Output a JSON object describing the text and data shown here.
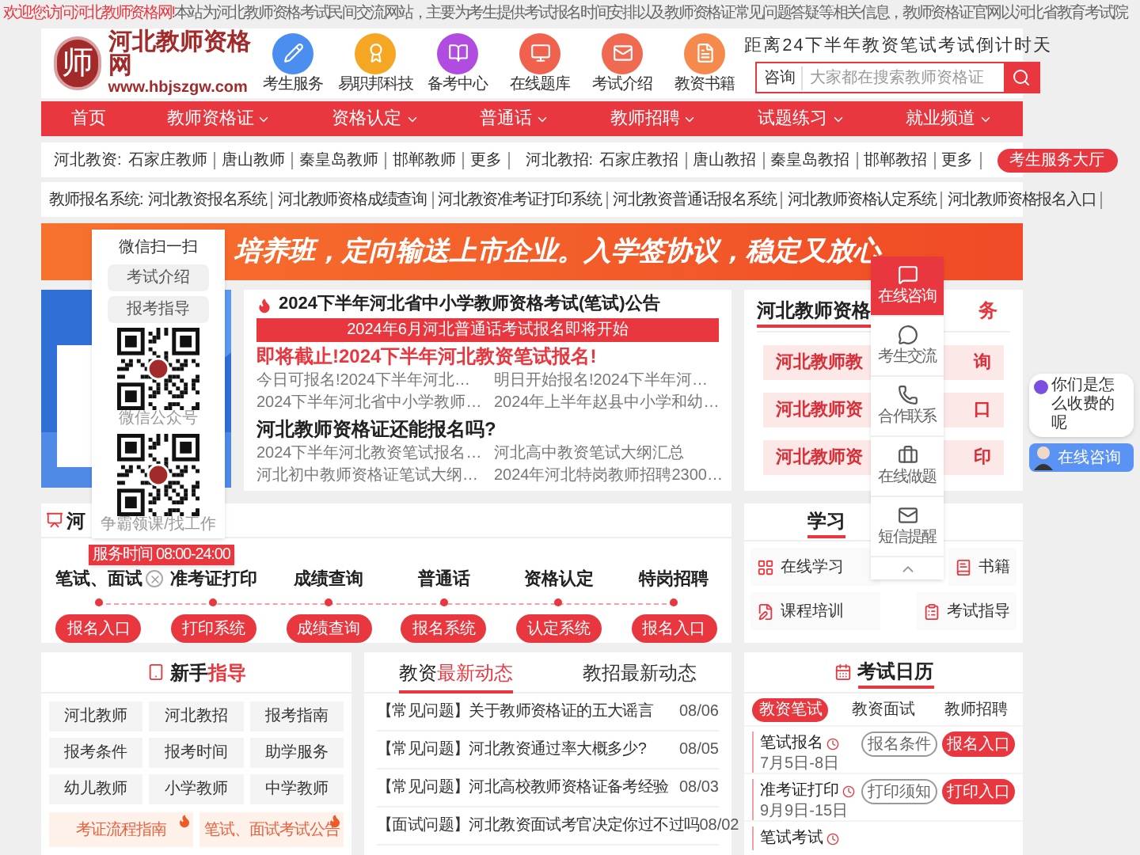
{
  "notice": {
    "welcome": "欢迎您访问河北教师资格网!",
    "text": "本站为河北教师资格考试民间交流网站，主要为考生提供考试报名时间安排以及教师资格证常见问题答疑等相关信息，教师资格证官网以河北省教育考试院"
  },
  "header": {
    "logo_mark": "师",
    "site_name": "河北教师资格网",
    "site_url": "www.hbjszgw.com",
    "shortcuts": [
      {
        "label": "考生服务",
        "color": "#4a8ef0"
      },
      {
        "label": "易职邦科技",
        "color": "#f5a623"
      },
      {
        "label": "备考中心",
        "color": "#b04ce0"
      },
      {
        "label": "在线题库",
        "color": "#f0624d"
      },
      {
        "label": "考试介绍",
        "color": "#f06a52"
      },
      {
        "label": "教资书籍",
        "color": "#f58a4c"
      }
    ],
    "countdown": "距离24下半年教资笔试考试倒计时天",
    "search": {
      "label": "咨询",
      "placeholder": "大家都在搜索教师资格证"
    }
  },
  "nav": [
    {
      "label": "首页",
      "dropdown": false
    },
    {
      "label": "教师资格证",
      "dropdown": true
    },
    {
      "label": "资格认定",
      "dropdown": true
    },
    {
      "label": "普通话",
      "dropdown": true
    },
    {
      "label": "教师招聘",
      "dropdown": true
    },
    {
      "label": "试题练习",
      "dropdown": true
    },
    {
      "label": "就业频道",
      "dropdown": true
    }
  ],
  "city_links": [
    {
      "label": "河北教资:",
      "items": [
        "石家庄教师",
        "唐山教师",
        "秦皇岛教师",
        "邯郸教师",
        "更多"
      ]
    },
    {
      "label": "河北教招:",
      "items": [
        "石家庄教招",
        "唐山教招",
        "秦皇岛教招",
        "邯郸教招",
        "更多"
      ]
    }
  ],
  "service_hall_button": "考生服务大厅",
  "systems": {
    "label": "教师报名系统:",
    "items": [
      "河北教资报名系统",
      "河北教师资格成绩查询",
      "河北教资准考证打印系统",
      "河北教资普通话报名系统",
      "河北教师资格认定系统",
      "河北教师资格报名入口"
    ]
  },
  "banner": {
    "text": "培养班，定向输送上市企业。入学签协议，稳定又放心"
  },
  "news": {
    "headline": "2024下半年河北省中小学教师资格考试(笔试)公告",
    "bar": "2024年6月河北普通话考试报名即将开始",
    "alert": "即将截止!2024下半年河北教资笔试报名!",
    "links": [
      "今日可报名!2024下半年河北…",
      "明日开始报名!2024下半年河…",
      "2024下半年河北省中小学教师…",
      "2024年上半年赵县中小学和幼…"
    ],
    "question": "河北教师资格证还能报名吗?",
    "question_links": [
      "2024下半年河北教资笔试报名…",
      "河北高中教资笔试大纲汇总",
      "河北初中教师资格证笔试大纲…",
      "2024年河北特岗教师招聘2300…"
    ]
  },
  "service_panel": {
    "title": "河北教师资格",
    "title_end": "务",
    "items": [
      {
        "start": "河北教师教",
        "end": "询"
      },
      {
        "start": "河北教师资",
        "end": "口"
      },
      {
        "start": "河北教师资",
        "end": "印"
      }
    ]
  },
  "process": {
    "title": "河",
    "steps": [
      {
        "label": "笔试、面试",
        "button": "报名入口"
      },
      {
        "label": "准考证打印",
        "button": "打印系统"
      },
      {
        "label": "成绩查询",
        "button": "成绩查询"
      },
      {
        "label": "普通话",
        "button": "报名系统"
      },
      {
        "label": "资格认定",
        "button": "认定系统"
      },
      {
        "label": "特岗招聘",
        "button": "报名入口"
      }
    ]
  },
  "study": {
    "title": "学习",
    "items": [
      {
        "label": "在线学习"
      },
      {
        "label": "书籍"
      },
      {
        "label": "课程培训"
      },
      {
        "label": "考试指导"
      }
    ]
  },
  "guide": {
    "title": "新手",
    "title_highlight": "指导",
    "items": [
      "河北教师",
      "河北教招",
      "报考指南",
      "报考条件",
      "报考时间",
      "助学服务",
      "幼儿教师",
      "小学教师",
      "中学教师"
    ],
    "hot_links": [
      {
        "label": "考证流程指南",
        "hot": true
      },
      {
        "label": "笔试、面试考试公告",
        "hot": true
      }
    ]
  },
  "latest": {
    "tabs": [
      {
        "prefix": "教资",
        "label": "最新动态",
        "selected": true
      },
      {
        "prefix": "教招",
        "label": "最新动态",
        "selected": false
      }
    ],
    "rows": [
      {
        "tag": "【常见问题】",
        "title": "关于教师资格证的五大谣言",
        "date": "08/06"
      },
      {
        "tag": "【常见问题】",
        "title": "河北教资通过率大概多少?",
        "date": "08/05"
      },
      {
        "tag": "【常见问题】",
        "title": "河北高校教师资格证备考经验",
        "date": "08/03"
      },
      {
        "tag": "【面试问题】",
        "title": "河北教资面试考官决定你过不过吗",
        "date": "08/02"
      }
    ]
  },
  "calendar": {
    "title": "考试日历",
    "tabs": [
      {
        "label": "教资笔试",
        "selected": true
      },
      {
        "label": "教资面试",
        "selected": false
      },
      {
        "label": "教师招聘",
        "selected": false
      }
    ],
    "entries": [
      {
        "name": "笔试报名",
        "date": "7月5日-8日",
        "buttons": [
          {
            "label": "报名条件",
            "kind": "outline"
          },
          {
            "label": "报名入口",
            "kind": "filled"
          }
        ]
      },
      {
        "name": "准考证打印",
        "date": "9月9日-15日",
        "buttons": [
          {
            "label": "打印须知",
            "kind": "outline"
          },
          {
            "label": "打印入口",
            "kind": "filled"
          }
        ]
      },
      {
        "name": "笔试考试"
      }
    ]
  },
  "wechat_popup": {
    "title": "微信扫一扫",
    "buttons": [
      "考试介绍",
      "报考指导"
    ],
    "captions": [
      "微信公众号",
      "争霸领课/找工作"
    ],
    "hours": "服务时间 08:00-24:00"
  },
  "side_menu": [
    {
      "label": "在线咨询",
      "selected": true
    },
    {
      "label": "考生交流",
      "selected": false
    },
    {
      "label": "合作联系",
      "selected": false
    },
    {
      "label": "在线做题",
      "selected": false
    },
    {
      "label": "短信提醒",
      "selected": false
    }
  ],
  "chat": {
    "question": "你们是怎么收费的呢",
    "button": "在线咨询"
  }
}
